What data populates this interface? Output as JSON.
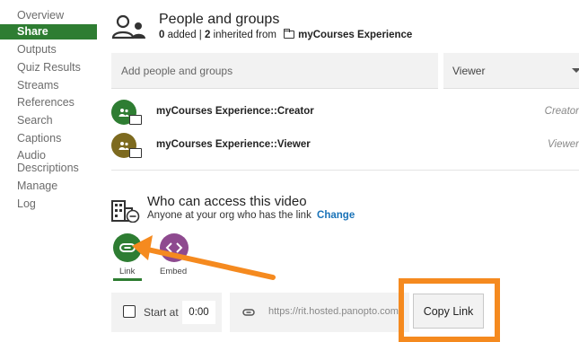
{
  "sidebar": {
    "items": [
      {
        "label": "Overview",
        "active": false
      },
      {
        "label": "Share",
        "active": true
      },
      {
        "label": "Outputs",
        "active": false
      },
      {
        "label": "Quiz Results",
        "active": false
      },
      {
        "label": "Streams",
        "active": false
      },
      {
        "label": "References",
        "active": false
      },
      {
        "label": "Search",
        "active": false
      },
      {
        "label": "Captions",
        "active": false
      },
      {
        "label": "Audio",
        "active": false
      },
      {
        "label": "Descriptions",
        "active": false
      },
      {
        "label": "Manage",
        "active": false
      },
      {
        "label": "Log",
        "active": false
      }
    ]
  },
  "people": {
    "title": "People and groups",
    "added_count": "0",
    "added_text": "added",
    "separator": "|",
    "inherited_count": "2",
    "inherited_text": "inherited from",
    "source_folder": "myCourses Experience",
    "add_placeholder": "Add people and groups",
    "role_selected": "Viewer",
    "groups": [
      {
        "name": "myCourses Experience::Creator",
        "role": "Creator",
        "color": "#2e7d32"
      },
      {
        "name": "myCourses Experience::Viewer",
        "role": "Viewer",
        "color": "#7d6a1f"
      }
    ]
  },
  "access": {
    "title": "Who can access this video",
    "subtitle": "Anyone at your org who has the link",
    "change_label": "Change"
  },
  "share_tabs": [
    {
      "label": "Link",
      "active": true,
      "color": "#2e7d32",
      "icon": "link-icon"
    },
    {
      "label": "Embed",
      "active": false,
      "color": "#8e4a8f",
      "icon": "code-icon"
    }
  ],
  "start": {
    "label": "Start at",
    "time": "0:00"
  },
  "link": {
    "url": "https://rit.hosted.panopto.com",
    "copy_label": "Copy Link"
  },
  "colors": {
    "accent": "#2e7d32",
    "annotation": "#f58a1f",
    "link": "#1a73b8"
  }
}
